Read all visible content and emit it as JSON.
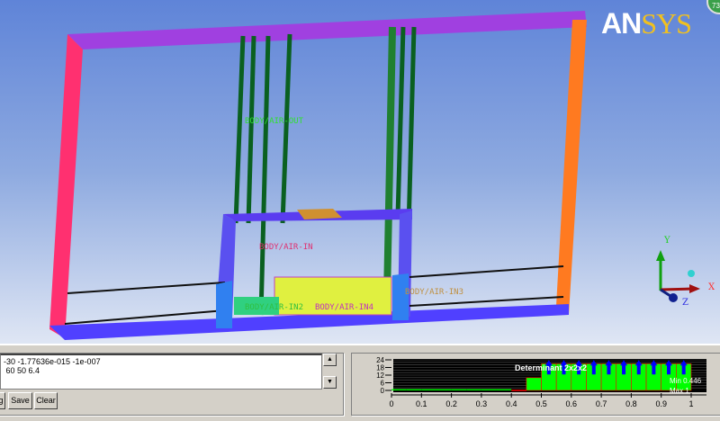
{
  "viewport": {
    "labels": {
      "air_out": "BODY/AIR-OUT",
      "air_in": "BODY/AIR-IN",
      "air_in2": "BODY/AIR-IN2",
      "air_in3": "BODY/AIR-IN3",
      "air_in4": "BODY/AIR-IN4"
    },
    "logo": "ANSYS",
    "badge": "73",
    "triad": {
      "x": "X",
      "y": "Y",
      "z": "Z"
    }
  },
  "console": {
    "lines": [
      "-30 -1.77636e-015 -1e-007",
      " 60 50 6.4"
    ],
    "buttons": {
      "partial": "g",
      "save": "Save",
      "clear": "Clear"
    },
    "scroll_up": "▲",
    "scroll_down": "▼"
  },
  "chart_data": {
    "type": "bar",
    "title": "Determinant 2x2x2",
    "bin_edges": [
      0,
      0.05,
      0.1,
      0.15,
      0.2,
      0.25,
      0.3,
      0.35,
      0.4,
      0.45,
      0.5,
      0.55,
      0.6,
      0.65,
      0.7,
      0.75,
      0.8,
      0.85,
      0.9,
      0.95,
      1.0
    ],
    "values": [
      1,
      1,
      1,
      1,
      1,
      1,
      1,
      1,
      0,
      10,
      21,
      21,
      21,
      21,
      21,
      21,
      21,
      21,
      21,
      21
    ],
    "xticks": [
      "0",
      "0.1",
      "0.2",
      "0.3",
      "0.4",
      "0.5",
      "0.6",
      "0.7",
      "0.8",
      "0.9",
      "1"
    ],
    "yticks": [
      "0",
      "6",
      "12",
      "18",
      "24"
    ],
    "xlim": [
      0,
      1
    ],
    "ylim": [
      0,
      24
    ],
    "min_label": "Min 0.446",
    "max_label": "Max 1",
    "colors": {
      "bar": "#00ff00",
      "edge": "#ff0000",
      "arrow": "#0000ff",
      "bg": "#000000"
    }
  }
}
